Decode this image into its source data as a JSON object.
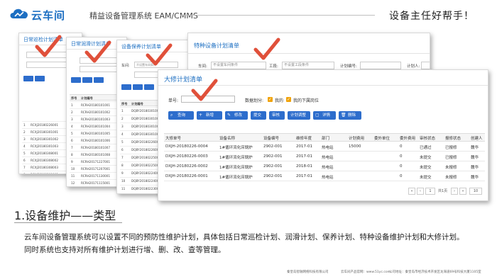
{
  "header": {
    "logo_text": "云车间",
    "subtitle": "精益设备管理系统 EAM/CMMS",
    "slogan": "设备主任好帮手！",
    "brand_color": "#1d6fc2"
  },
  "panels": {
    "p1": {
      "title": "日常巡检计划清单",
      "rows": [
        [
          "1",
          "RCXJ20180226001"
        ],
        [
          "2",
          "RCXJ20180301001"
        ],
        [
          "3",
          "RCXJ20180301002"
        ],
        [
          "4",
          "RCXJ20180301003"
        ],
        [
          "5",
          "RCXJ20180308001"
        ],
        [
          "6",
          "RCXJ20180308002"
        ],
        [
          "7",
          "RCXJ20180308003"
        ],
        [
          "8",
          "RCXJ20180309001"
        ],
        [
          "9",
          "RCXJ20180309002"
        ],
        [
          "10",
          "RCXJ20180310001"
        ]
      ]
    },
    "p2": {
      "title": "日常润滑计划清单",
      "col_no": "序号",
      "col_code": "计划编号",
      "rows": [
        [
          "1",
          "RCRH20180101001"
        ],
        [
          "2",
          "RCRH20180101002"
        ],
        [
          "3",
          "RCRH20180101003"
        ],
        [
          "4",
          "RCRH20180101004"
        ],
        [
          "5",
          "RCRH20180101005"
        ],
        [
          "6",
          "RCRH20180101006"
        ],
        [
          "7",
          "RCRH20180101007"
        ],
        [
          "8",
          "RCRH20180101008"
        ],
        [
          "9",
          "RCRH20171227001"
        ],
        [
          "10",
          "RCRH20171207001"
        ],
        [
          "11",
          "RCRH20171130001"
        ],
        [
          "12",
          "RCRH20171115001"
        ]
      ]
    },
    "p3": {
      "title": "设备保养计划清单",
      "car_label": "车间:",
      "car_placeholder": "不设置车间条件",
      "col_no": "序号",
      "col_code": "计划编号",
      "rows": [
        [
          "1",
          "DQBY20180301001"
        ],
        [
          "2",
          "DQBY20180301002"
        ],
        [
          "3",
          "DQBY20180301003"
        ],
        [
          "4",
          "DQBY20180301004"
        ],
        [
          "5",
          "DQBY20180226001"
        ],
        [
          "6",
          "DQBY20180226002"
        ],
        [
          "7",
          "DQBY20180225001"
        ],
        [
          "8",
          "DQBY20180225002"
        ],
        [
          "9",
          "DQBY20180224001"
        ],
        [
          "10",
          "DQBY20180224002"
        ],
        [
          "11",
          "DQBY20180223001"
        ]
      ]
    },
    "p4": {
      "title": "特种设备计划清单",
      "car_label": "车间:",
      "car_placeholder": "不设置车间条件",
      "process_label": "工段:",
      "process_placeholder": "不设置工段条件",
      "plan_no_label": "计划编号:",
      "planner_label": "计划人:"
    }
  },
  "front": {
    "title": "大修计划清单",
    "form": {
      "no_label": "单号:",
      "score_label": "数据划分:",
      "mine_label": "我的",
      "sub_label": "我的下属岗位"
    },
    "toolbar": [
      {
        "icon": "search-icon",
        "glyph": "⌕",
        "label": "查询"
      },
      {
        "icon": "plus-icon",
        "glyph": "+",
        "label": "新增"
      },
      {
        "icon": "edit-icon",
        "glyph": "✎",
        "label": "修改"
      },
      {
        "icon": "",
        "glyph": "",
        "label": "提交"
      },
      {
        "icon": "",
        "glyph": "",
        "label": "审核"
      },
      {
        "icon": "",
        "glyph": "",
        "label": "计划调整"
      },
      {
        "icon": "detail-icon",
        "glyph": "▢",
        "label": "详情"
      },
      {
        "icon": "delete-icon",
        "glyph": "🗑",
        "label": "删除"
      }
    ],
    "columns": [
      "大修单号",
      "设备名称",
      "设备编号",
      "维修年度",
      "部门",
      "计划费用",
      "委外单位",
      "委外费用",
      "审核状态",
      "报修状态",
      "创建人"
    ],
    "rows": [
      [
        "DXJH-20180226-0004",
        "1#循环流化床锅炉",
        "2902-001",
        "2017-01",
        "热电站",
        "15000",
        "",
        "0",
        "已通过",
        "已报修",
        "魏华"
      ],
      [
        "DXJH-20180226-0003",
        "1#循环流化床锅炉",
        "2902-001",
        "2017-01",
        "热电站",
        "",
        "",
        "0",
        "未提交",
        "已报修",
        "魏华"
      ],
      [
        "DXJH-20180226-0002",
        "1#循环流化床锅炉",
        "2902-001",
        "2018-01",
        "热电站",
        "",
        "",
        "0",
        "未提交",
        "未报修",
        "魏华"
      ],
      [
        "DXJH-20180226-0001",
        "1#循环流化床锅炉",
        "2902-001",
        "2017-01",
        "热电站",
        "",
        "",
        "0",
        "未提交",
        "未报修",
        "魏华"
      ]
    ],
    "pager": {
      "page": "1",
      "total": "共1页",
      "size": "10"
    }
  },
  "section": {
    "title": "1.设备维护——类型",
    "line1": "云车间设备管理系统可以设置不同的预防性维护计划，具体包括日常巡检计划、润滑计划、保养计划、特种设备维护计划和大修计划。",
    "line2": "同时系统也支持对所有维护计划进行增、删、改、查等管理。"
  },
  "footer": {
    "company": "秦皇岛智融网络科技有限公司",
    "website": "云车间产品官网：www.51yc.com",
    "address": "公司地址：秦皇岛市经济技术开发区龙海道69号科技大厦1105室"
  },
  "colors": {
    "check_red": "#e0503a",
    "button_blue": "#2d6dcc",
    "checkbox_orange": "#f0a30a"
  }
}
